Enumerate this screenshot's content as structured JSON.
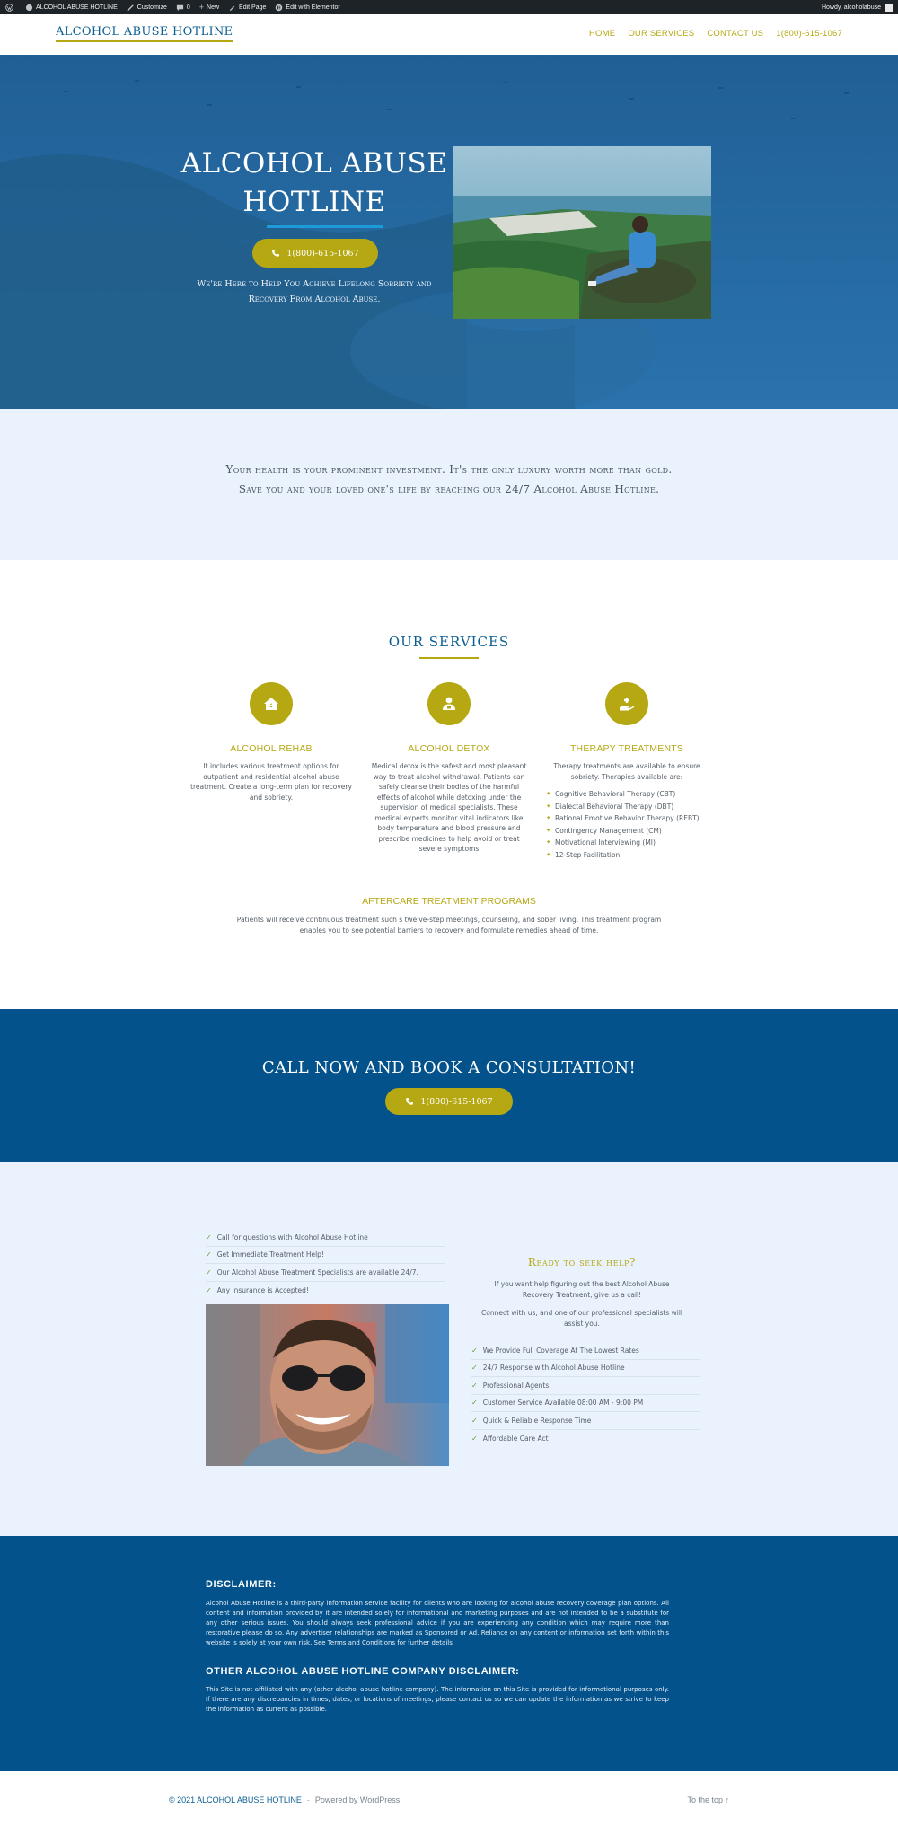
{
  "admin_bar": {
    "site_name": "ALCOHOL ABUSE HOTLINE",
    "customize": "Customize",
    "comments_count": "0",
    "new": "New",
    "edit_page": "Edit Page",
    "edit_elementor": "Edit with Elementor",
    "howdy": "Howdy, alcoholabuse"
  },
  "header": {
    "logo": "ALCOHOL ABUSE HOTLINE",
    "nav": [
      "HOME",
      "OUR SERVICES",
      "CONTACT US",
      "1(800)-615-1067"
    ]
  },
  "hero": {
    "title_line1": "Alcohol Abuse",
    "title_line2": "Hotline",
    "phone_button": "1(800)-615-1067",
    "tagline_line1": "We're Here to Help You Achieve Lifelong Sobriety and",
    "tagline_line2": "Recovery From Alcohol Abuse."
  },
  "quote": {
    "line1": "Your health is your prominent investment. It's the only luxury worth more than gold.",
    "line2": "Save you and your loved one's life by reaching our 24/7 Alcohol Abuse Hotline."
  },
  "services": {
    "title": "OUR SERVICES",
    "items": [
      {
        "icon": "house-icon",
        "title": "ALCOHOL REHAB",
        "body": "It includes various treatment options for outpatient and residential alcohol abuse treatment. Create a long-term plan for recovery and sobriety."
      },
      {
        "icon": "medic-icon",
        "title": "ALCOHOL DETOX",
        "body": "Medical detox is the safest and most pleasant way to treat alcohol withdrawal. Patients can safely cleanse their bodies of the harmful effects of alcohol while detoxing under the supervision of medical specialists. These medical experts monitor vital indicators like body temperature and blood pressure and prescribe medicines to help avoid or treat severe symptoms"
      },
      {
        "icon": "hand-care-icon",
        "title": "THERAPY TREATMENTS",
        "body": "Therapy treatments are available to ensure sobriety. Therapies available are:",
        "list": [
          "Cognitive Behavioral Therapy (CBT)",
          "Dialectal Behavioral Therapy (DBT)",
          "Rational Emotive Behavior Therapy (REBT)",
          "Contingency Management (CM)",
          "Motivational Interviewing (MI)",
          "12-Step Facilitation"
        ]
      }
    ],
    "aftercare_title": "AFTERCARE TREATMENT PROGRAMS",
    "aftercare_body": "Patients will receive continuous treatment such s twelve-step meetings, counseling, and sober living. This treatment program enables you to see potential barriers to recovery and formulate remedies ahead of time."
  },
  "cta": {
    "title": "CALL NOW AND BOOK A CONSULTATION!",
    "button": "1(800)-615-1067"
  },
  "help": {
    "left_list": [
      "Call for questions with Alcohol Abuse Hotline",
      "Get Immediate Treatment Help!",
      "Our Alcohol Abuse Treatment Specialists are available 24/7.",
      "Any Insurance is Accepted!"
    ],
    "right_title": "Ready to seek help?",
    "right_p1": "If you want help figuring out the best Alcohol Abuse Recovery Treatment, give us a call!",
    "right_p2": "Connect with us, and one of our professional specialists will assist you.",
    "right_list": [
      "We Provide Full Coverage At The Lowest Rates",
      "24/7 Response with Alcohol Abuse Hotline",
      "Professional Agents",
      "Customer Service Available 08:00 AM - 9:00 PM",
      "Quick & Reliable Response Time",
      "Affordable Care Act"
    ]
  },
  "disclaimer": {
    "title1": "DISCLAIMER:",
    "body1": "Alcohol Abuse Hotline is a third-party information service facility for clients who are looking for alcohol abuse recovery coverage plan options. All content and information provided by it are intended solely for informational and marketing purposes and are not intended to be a substitute for any other serious issues. You should always seek professional advice if you are experiencing any condition which may require more than restorative please do so. Any advertiser relationships are marked as Sponsored or Ad. Reliance on any content or information set forth within this website is solely at your own risk. See Terms and Conditions for further details",
    "title2": "OTHER ALCOHOL ABUSE HOTLINE COMPANY DISCLAIMER:",
    "body2": "This Site is not affiliated with any (other alcohol abuse hotline company). The information on this Site is provided for informational purposes only. If there are any discrepancies in times, dates, or locations of meetings, please contact us so we can update the information as we strive to keep the information as current as possible."
  },
  "footer": {
    "copyright": "© 2021 ALCOHOL ABUSE HOTLINE",
    "separator": "-",
    "powered": "Powered by WordPress",
    "to_top": "To the top ↑"
  },
  "colors": {
    "primary_blue": "#03528b",
    "accent_gold": "#b6a813",
    "light_band": "#eaf3fd"
  }
}
